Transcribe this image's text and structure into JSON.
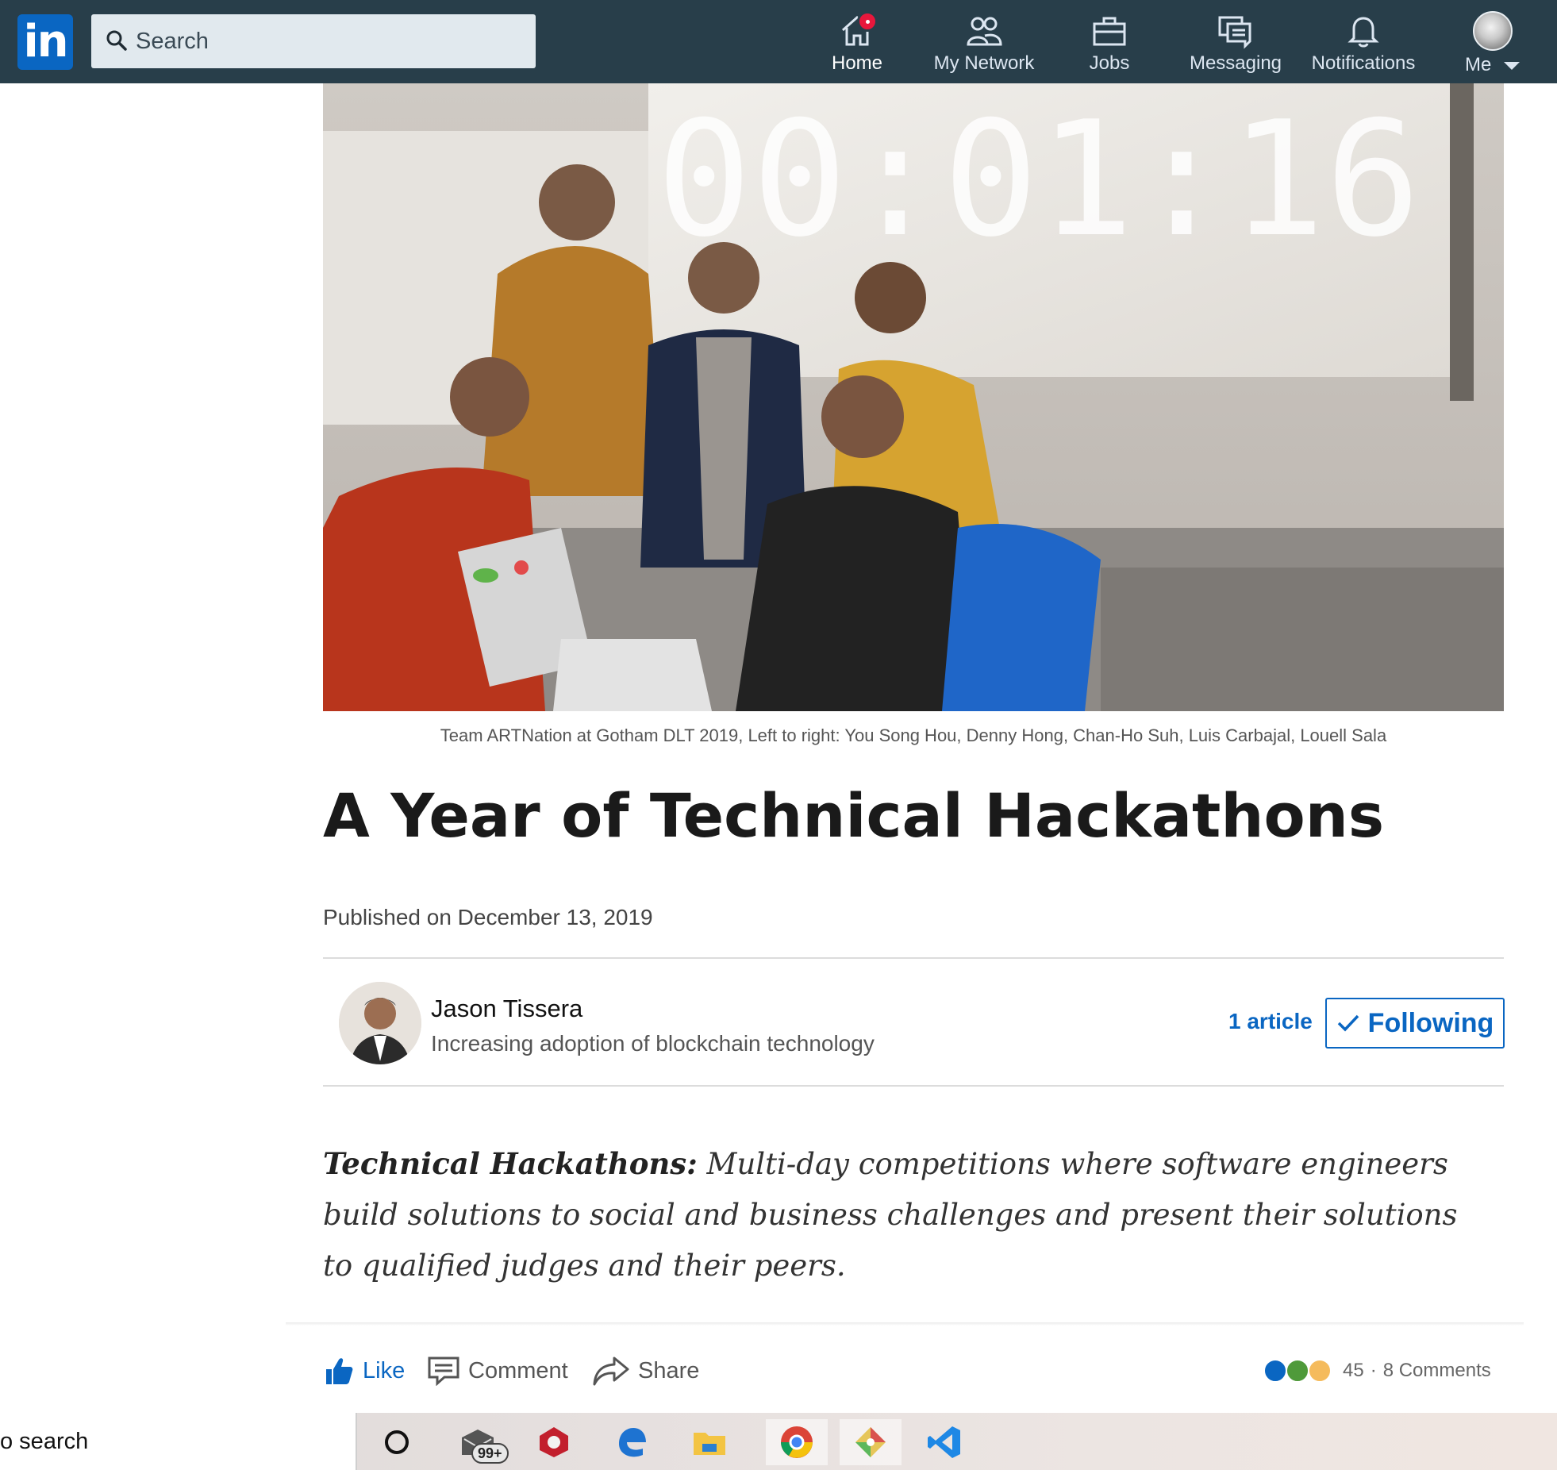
{
  "nav": {
    "logo_text": "in",
    "search_placeholder": "Search",
    "items": [
      {
        "label": "Home",
        "icon": "home-icon"
      },
      {
        "label": "My Network",
        "icon": "people-icon"
      },
      {
        "label": "Jobs",
        "icon": "briefcase-icon"
      },
      {
        "label": "Messaging",
        "icon": "chat-icon"
      },
      {
        "label": "Notifications",
        "icon": "bell-icon"
      },
      {
        "label": "Me",
        "icon": "avatar"
      }
    ],
    "brand_color": "#0a66c2",
    "bar_color": "#283e4a"
  },
  "article": {
    "hero_clock_text": "00:01:16",
    "caption": "Team ARTNation at Gotham DLT 2019, Left to right: You Song Hou, Denny Hong, Chan-Ho Suh, Luis Carbajal, Louell Sala",
    "title": "A Year of Technical Hackathons",
    "published": "Published on December 13, 2019",
    "author": {
      "name": "Jason Tissera",
      "headline": "Increasing adoption of blockchain technology",
      "articles_link": "1 article",
      "follow_label": "Following"
    },
    "intro_term": "Technical Hackathons:",
    "intro_text": " Multi-day competitions where software engineers build solutions to social and business challenges and present their solutions to qualified judges and their peers."
  },
  "social": {
    "like_label": "Like",
    "comment_label": "Comment",
    "share_label": "Share",
    "reaction_count": "45",
    "separator": "·",
    "comments_count": "8 Comments"
  },
  "taskbar": {
    "search_value": "o search",
    "mail_badge": "99+",
    "apps": [
      "cortana-icon",
      "mail-icon",
      "app-icon",
      "edge-icon",
      "file-explorer-icon",
      "chrome-icon",
      "git-icon",
      "vscode-icon"
    ]
  }
}
